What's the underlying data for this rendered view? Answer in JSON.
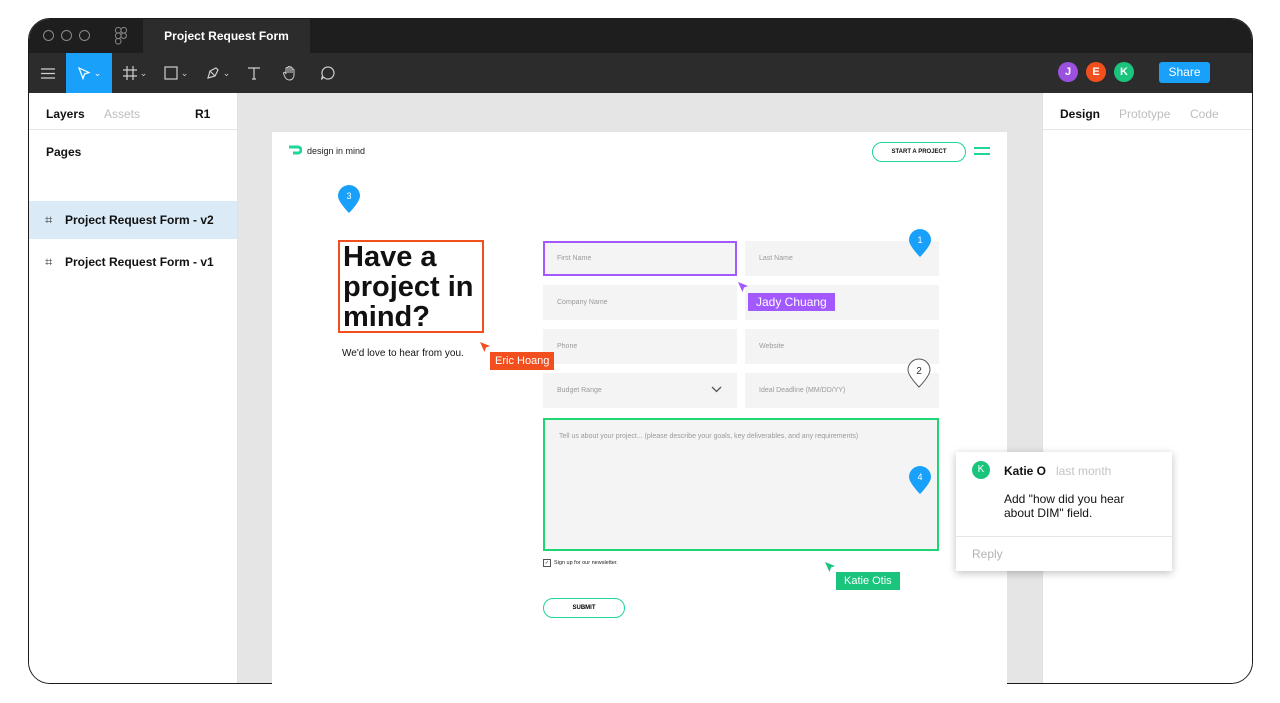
{
  "window": {
    "tab_title": "Project Request Form"
  },
  "toolbar": {
    "tools": [
      "menu-icon",
      "move-icon",
      "frame-icon",
      "rectangle-icon",
      "pen-icon",
      "text-icon",
      "hand-icon",
      "comment-icon"
    ],
    "avatars": [
      {
        "initial": "J",
        "color": "#9b51e0"
      },
      {
        "initial": "E",
        "color": "#f24e1e"
      },
      {
        "initial": "K",
        "color": "#1bc47d"
      }
    ],
    "share_label": "Share"
  },
  "left_panel": {
    "tabs": {
      "layers": "Layers",
      "assets": "Assets",
      "page_code": "R1"
    },
    "pages_heading": "Pages",
    "pages": [
      {
        "label": "Project Request Form - v2",
        "selected": true
      },
      {
        "label": "Project Request Form - v1",
        "selected": false
      }
    ]
  },
  "right_panel": {
    "tabs": {
      "design": "Design",
      "prototype": "Prototype",
      "code": "Code"
    }
  },
  "canvas": {
    "brand": "design in mind",
    "start_button": "START A PROJECT",
    "headline_lines": [
      "Have a",
      "project in",
      "mind?"
    ],
    "subline": "We'd love to hear from you.",
    "fields": {
      "first_name": "First Name",
      "last_name": "Last Name",
      "company": "Company Name",
      "phone": "Phone",
      "website": "Website",
      "budget": "Budget Range",
      "deadline": "Ideal Deadline (MM/DD/YY)",
      "message": "Tell us about your project... (please describe your goals, key deliverables, and any requirements)"
    },
    "newsletter": "Sign up for our newsletter.",
    "submit": "SUBMIT"
  },
  "comment_pins": [
    "1",
    "2",
    "3",
    "4"
  ],
  "cursors": {
    "jady": "Jady Chuang",
    "eric": "Eric Hoang",
    "katie": "Katie Otis"
  },
  "comment": {
    "avatar": "K",
    "author": "Katie O",
    "time": "last month",
    "body": "Add \"how did you hear about DIM\" field.",
    "reply": "Reply"
  },
  "colors": {
    "figma_blue": "#18a0fb",
    "purple": "#a259ff",
    "orange": "#f24e1e",
    "green": "#1bc47d",
    "brand_green": "#1ed69a"
  }
}
